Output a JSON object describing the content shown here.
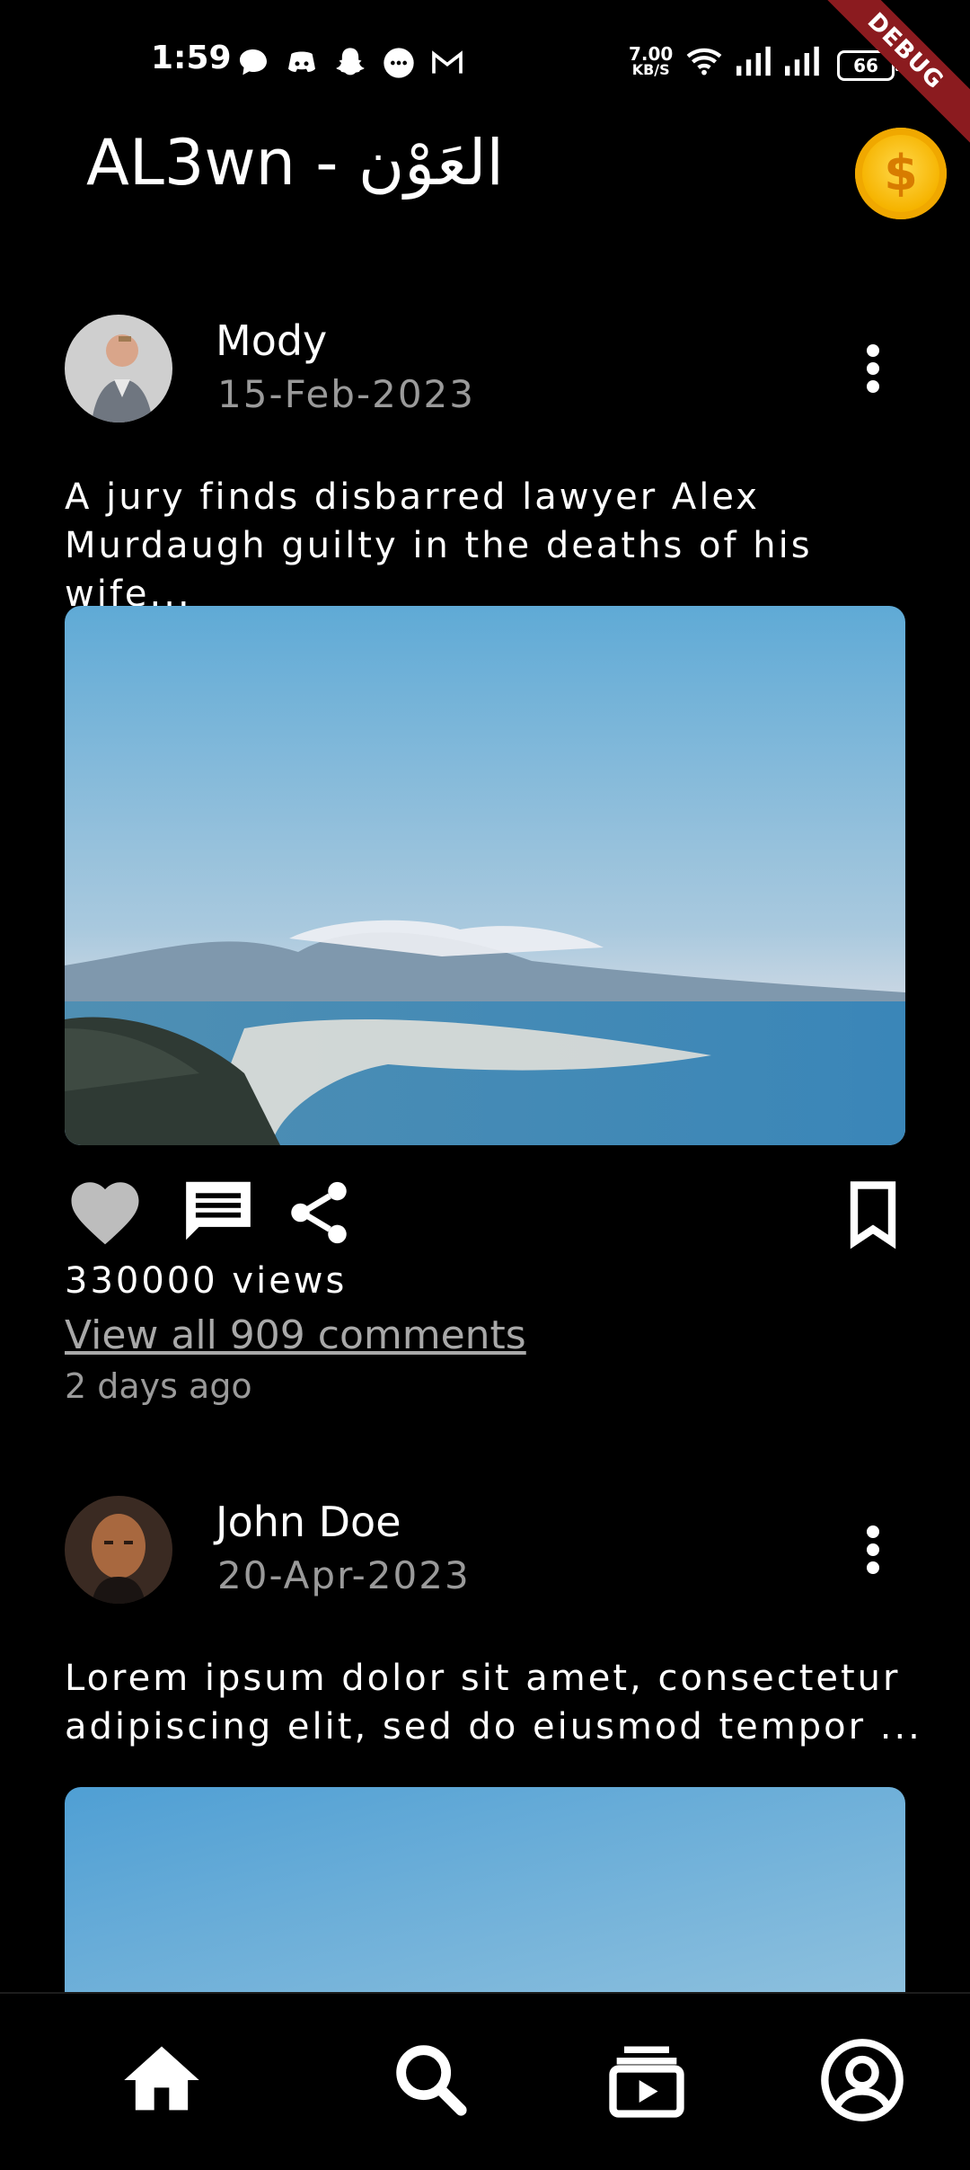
{
  "status_bar": {
    "time": "1:59",
    "net_speed_value": "7.00",
    "net_speed_unit": "KB/S",
    "battery": "66",
    "debug_label": "DEBUG"
  },
  "app_bar": {
    "title": "AL3wn - العَوْن",
    "coin_symbol": "$"
  },
  "posts": [
    {
      "author": "Mody",
      "date": "15-Feb-2023",
      "caption_line1": "A jury finds disbarred lawyer Alex",
      "caption_line2": "Murdaugh guilty in the deaths of his wife...",
      "views": "330000 views",
      "comments_link": "View all 909 comments",
      "time_ago": "2 days ago"
    },
    {
      "author": "John Doe",
      "date": "20-Apr-2023",
      "caption_line1": "Lorem ipsum dolor sit amet, consectetur",
      "caption_line2": "adipiscing elit, sed do eiusmod tempor ..."
    }
  ],
  "bottom_nav": {
    "items": [
      "home-icon",
      "search-icon",
      "videos-icon",
      "account-icon"
    ]
  },
  "colors": {
    "background": "#000000",
    "muted_text": "#9a9a9a",
    "coin": "#f6b400",
    "debug_ribbon": "#8b1b1f"
  }
}
